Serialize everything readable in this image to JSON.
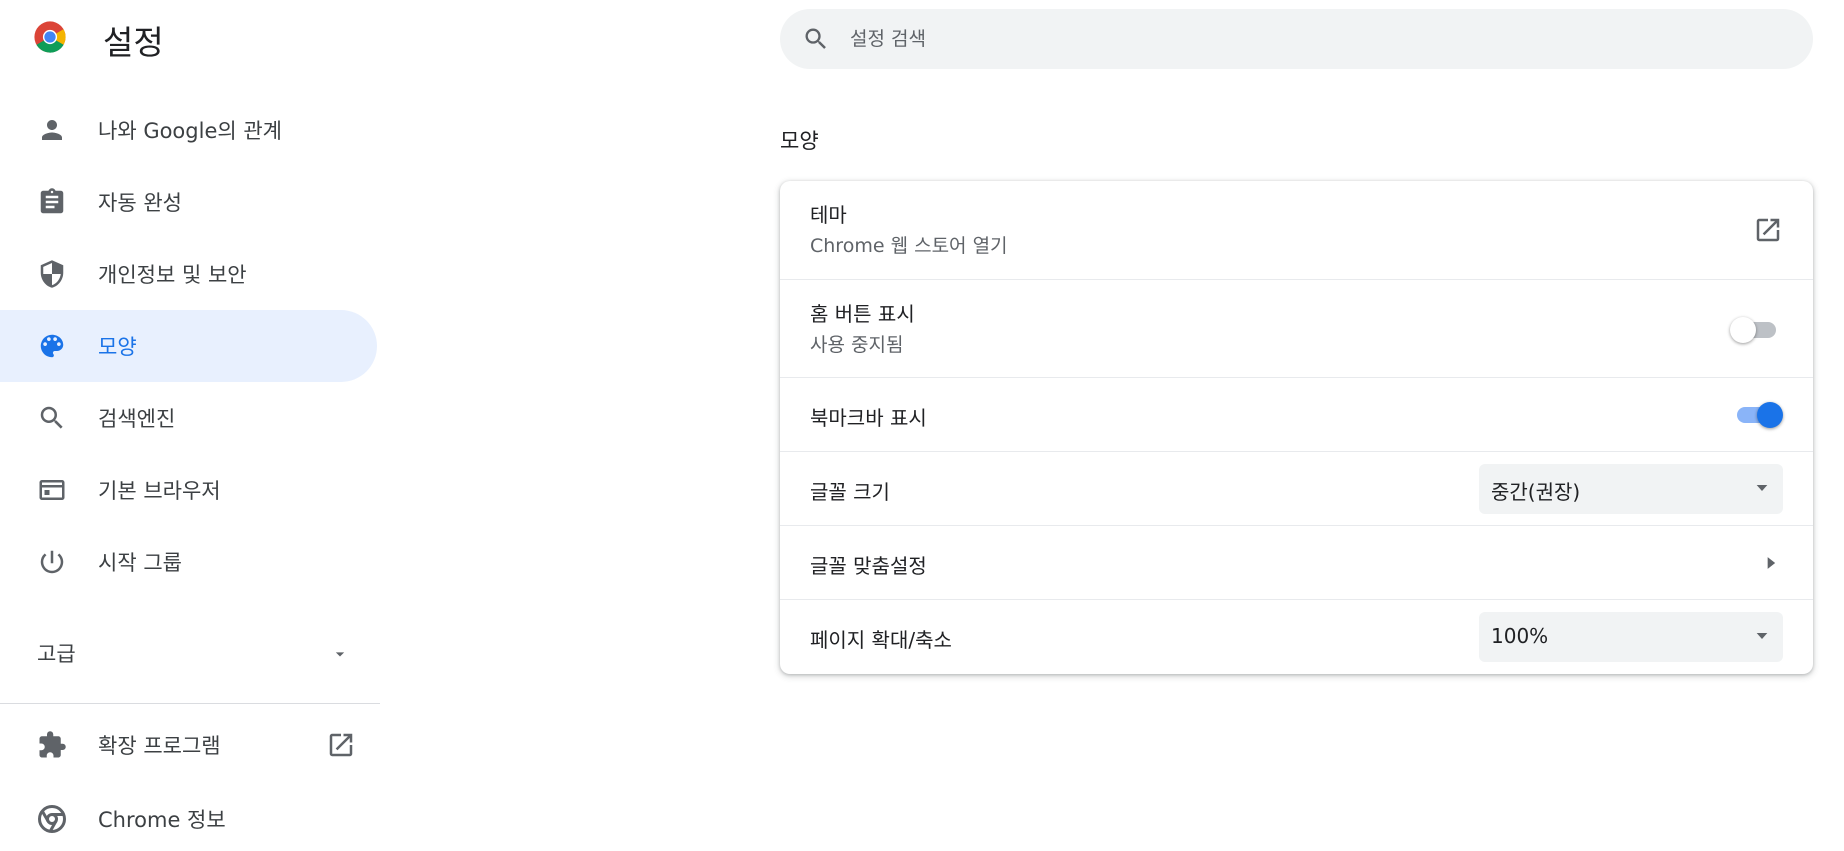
{
  "app": {
    "title": "설정"
  },
  "search": {
    "placeholder": "설정 검색",
    "value": ""
  },
  "sidebar": {
    "items": [
      {
        "label": "나와 Google의 관계",
        "icon": "person-icon",
        "active": false
      },
      {
        "label": "자동 완성",
        "icon": "clipboard-icon",
        "active": false
      },
      {
        "label": "개인정보 및 보안",
        "icon": "shield-icon",
        "active": false
      },
      {
        "label": "모양",
        "icon": "palette-icon",
        "active": true
      },
      {
        "label": "검색엔진",
        "icon": "search-icon",
        "active": false
      },
      {
        "label": "기본 브라우저",
        "icon": "browser-window-icon",
        "active": false
      },
      {
        "label": "시작 그룹",
        "icon": "power-icon",
        "active": false
      }
    ],
    "advanced_label": "고급",
    "extensions_label": "확장 프로그램",
    "about_label": "Chrome 정보"
  },
  "main": {
    "section_title": "모양",
    "rows": {
      "theme": {
        "title": "테마",
        "subtitle": "Chrome 웹 스토어 열기"
      },
      "home_button": {
        "title": "홈 버튼 표시",
        "subtitle": "사용 중지됨",
        "enabled": false
      },
      "bookmarks_bar": {
        "title": "북마크바 표시",
        "enabled": true
      },
      "font_size": {
        "title": "글꼴 크기",
        "value": "중간(권장)"
      },
      "customize_fonts": {
        "title": "글꼴 맞춤설정"
      },
      "page_zoom": {
        "title": "페이지 확대/축소",
        "value": "100%"
      }
    }
  },
  "colors": {
    "accent": "#1a73e8",
    "active_nav_bg": "#e8f0fe",
    "icon_gray": "#5f6368",
    "toggle_on_track": "#8ab4f8"
  }
}
